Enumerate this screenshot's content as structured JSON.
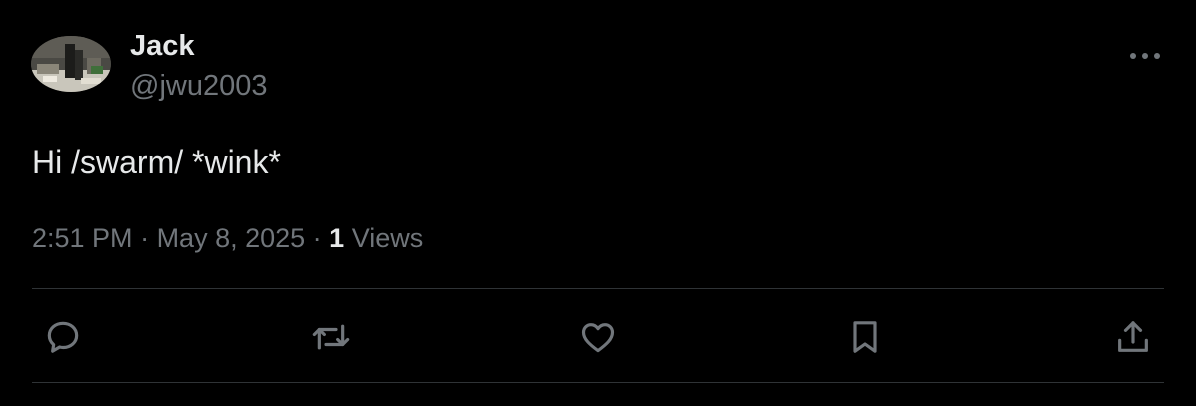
{
  "author": {
    "display_name": "Jack",
    "handle": "@jwu2003",
    "avatar_icon": "profile-photo"
  },
  "tweet": {
    "text": "Hi /swarm/ *wink*",
    "time": "2:51 PM",
    "separator": " · ",
    "date": "May 8, 2025",
    "views_count": "1",
    "views_label": " Views"
  },
  "icons": {
    "more": "more-horizontal-icon",
    "reply": "reply-bubble-icon",
    "retweet": "retweet-icon",
    "like": "heart-icon",
    "bookmark": "bookmark-icon",
    "share": "share-upload-icon"
  },
  "colors": {
    "background": "#000000",
    "primary_text": "#e7e9ea",
    "secondary_text": "#71767b",
    "divider": "#2f3336"
  }
}
